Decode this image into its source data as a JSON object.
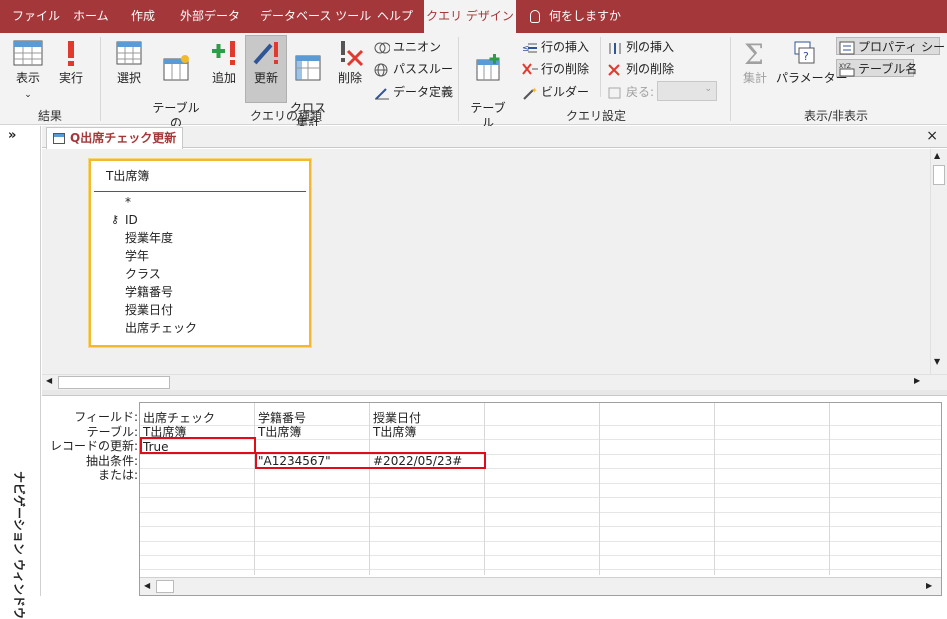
{
  "menu": {
    "tabs": [
      "ファイル",
      "ホーム",
      "作成",
      "外部データ",
      "データベース ツール",
      "ヘルプ",
      "クエリ デザイン"
    ],
    "tell_me": "何をしますか"
  },
  "ribbon": {
    "results": {
      "view": "表示",
      "run": "実行",
      "group": "結果"
    },
    "query_type": {
      "select": "選択",
      "make_table": "テーブルの\n作成",
      "append": "追加",
      "update": "更新",
      "crosstab": "クロス\n集計",
      "delete": "削除",
      "union": "ユニオン",
      "passthrough": "パススルー",
      "data_definition": "データ定義",
      "group": "クエリの種類"
    },
    "query_setup": {
      "add_table": "テーブル\nの追加",
      "insert_rows": "行の挿入",
      "delete_rows": "行の削除",
      "builder": "ビルダー",
      "insert_cols": "列の挿入",
      "delete_cols": "列の削除",
      "return": "戻る:",
      "group": "クエリ設定"
    },
    "show_hide": {
      "totals": "集計",
      "parameters": "パラメーター",
      "property_sheet": "プロパティ シート",
      "table_names": "テーブル名",
      "group": "表示/非表示"
    }
  },
  "nav_pane": {
    "label": "ナビゲーション ウィンドウ",
    "toggle": "»"
  },
  "document": {
    "tab_title": "Q出席チェック更新"
  },
  "table_box": {
    "name": "T出席簿",
    "fields": [
      "*",
      "ID",
      "授業年度",
      "学年",
      "クラス",
      "学籍番号",
      "授業日付",
      "出席チェック"
    ]
  },
  "design_grid": {
    "row_labels": [
      "フィールド:",
      "テーブル:",
      "レコードの更新:",
      "抽出条件:",
      "または:"
    ],
    "columns": [
      {
        "field": "出席チェック",
        "table": "T出席簿",
        "update": "True",
        "criteria": ""
      },
      {
        "field": "学籍番号",
        "table": "T出席簿",
        "update": "",
        "criteria": "\"A1234567\""
      },
      {
        "field": "授業日付",
        "table": "T出席簿",
        "update": "",
        "criteria": "#2022/05/23#"
      }
    ]
  },
  "colors": {
    "accent": "#a4373a",
    "highlight": "#e00d18",
    "table_border": "#f2b92f"
  }
}
